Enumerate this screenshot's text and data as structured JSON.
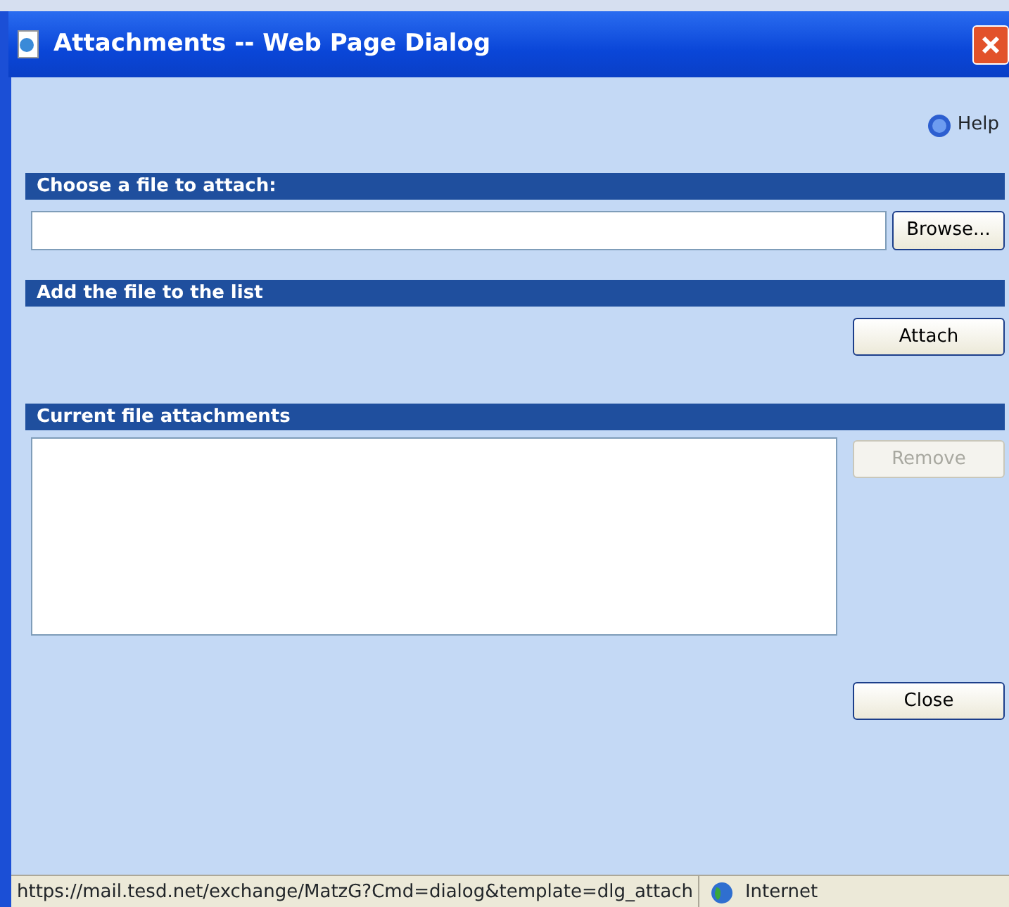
{
  "window": {
    "title": "Attachments -- Web Page Dialog"
  },
  "help": {
    "label": "Help"
  },
  "sections": [
    {
      "kind": "file",
      "title": "Choose a file to attach:",
      "button": {
        "label": "Browse...",
        "disabled": false
      }
    },
    {
      "kind": "attach",
      "title": "Add the file to the list",
      "button": {
        "label": "Attach",
        "disabled": false
      }
    },
    {
      "kind": "list",
      "title": "Current file attachments",
      "button": {
        "label": "Remove",
        "disabled": true
      }
    }
  ],
  "close_button": {
    "label": "Close",
    "disabled": false
  },
  "status_bar": {
    "url": "https://mail.tesd.net/exchange/MatzG?Cmd=dialog&template=dlg_attach",
    "zone": "Internet"
  }
}
